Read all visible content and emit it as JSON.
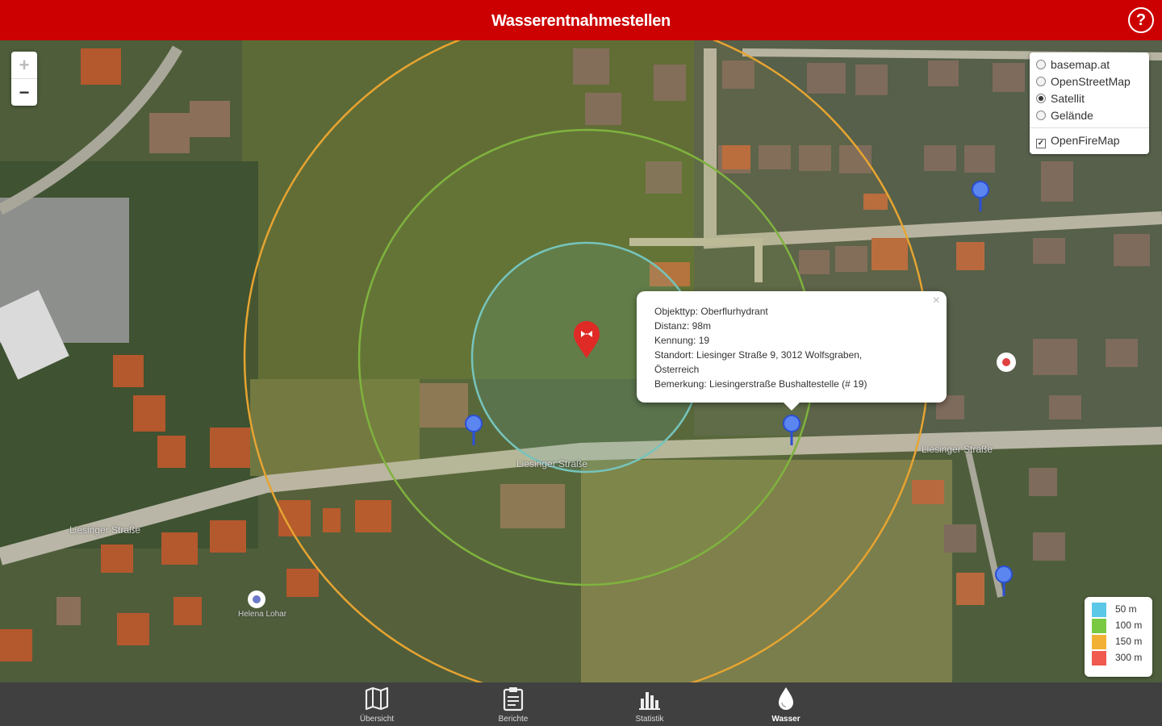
{
  "header": {
    "title": "Wasserentnahmestellen",
    "help_icon": "help-circle-icon",
    "background": "#cc0000"
  },
  "map": {
    "zoom_in_label": "+",
    "zoom_out_label": "−",
    "layers": {
      "options": [
        {
          "label": "basemap.at",
          "selected": false
        },
        {
          "label": "OpenStreetMap",
          "selected": false
        },
        {
          "label": "Satellit",
          "selected": true
        },
        {
          "label": "Gelände",
          "selected": false
        }
      ],
      "overlay": {
        "label": "OpenFireMap",
        "checked": true
      }
    },
    "streets": [
      "Liesinger Straße",
      "Liesinger Straße",
      "Liesinger Straße"
    ],
    "poi_label": "Helena Lohar"
  },
  "popup": {
    "close_label": "×",
    "lines": [
      "Objekttyp: Oberflurhydrant",
      "Distanz: 98m",
      "Kennung: 19",
      "Standort: Liesinger Straße 9, 3012 Wolfsgraben,",
      "Österreich",
      "Bemerkung: Liesingerstraße Bushaltestelle (# 19)"
    ]
  },
  "legend": {
    "items": [
      {
        "label": "50 m",
        "color": "#5bc8e8"
      },
      {
        "label": "100 m",
        "color": "#7ac943"
      },
      {
        "label": "150 m",
        "color": "#f2b134"
      },
      {
        "label": "300 m",
        "color": "#f05a4f"
      }
    ]
  },
  "nav": {
    "items": [
      {
        "label": "Übersicht",
        "icon": "map-icon",
        "active": false
      },
      {
        "label": "Berichte",
        "icon": "clipboard-icon",
        "active": false
      },
      {
        "label": "Statistik",
        "icon": "bar-chart-icon",
        "active": false
      },
      {
        "label": "Wasser",
        "icon": "water-drop-icon",
        "active": true
      }
    ]
  }
}
